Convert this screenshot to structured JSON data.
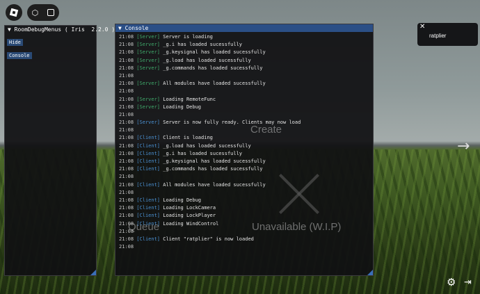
{
  "background": {
    "create_text": "Create",
    "unavailable_text": "Unavailable (W.I.P)",
    "queue_text": "Queue"
  },
  "colors": {
    "server_tag": "#3fa86a",
    "client_tag": "#4a8fcf",
    "title_bar": "#2b4f86",
    "button": "#2a4a75"
  },
  "topbar": {
    "icons": [
      "roblox-logo-icon",
      "cube-icon",
      "chat-list-icon"
    ]
  },
  "debug_menu": {
    "title": "RoomDebugMenus ( Iris  2.2.0 )",
    "buttons": [
      "Hide",
      "Console"
    ]
  },
  "console": {
    "title": "Console",
    "lines": [
      {
        "time": "21:08",
        "tag": "[Server]",
        "tag_type": "server",
        "text": "Server is loading"
      },
      {
        "time": "21:08",
        "tag": "[Server]",
        "tag_type": "server",
        "text": "_g.i has loaded sucessfully"
      },
      {
        "time": "21:08",
        "tag": "[Server]",
        "tag_type": "server",
        "text": "_g.keysignal has loaded sucessfully"
      },
      {
        "time": "21:08",
        "tag": "[Server]",
        "tag_type": "server",
        "text": "_g.load has loaded sucessfully"
      },
      {
        "time": "21:08",
        "tag": "[Server]",
        "tag_type": "server",
        "text": "_g.commands has loaded sucessfully"
      },
      {
        "time": "21:08",
        "tag": "",
        "tag_type": "",
        "text": ""
      },
      {
        "time": "21:08",
        "tag": "[Server]",
        "tag_type": "server",
        "text": "All modules have loaded sucessfully"
      },
      {
        "time": "21:08",
        "tag": "",
        "tag_type": "",
        "text": ""
      },
      {
        "time": "21:08",
        "tag": "[Server]",
        "tag_type": "server",
        "text": "Loading RemoteFunc"
      },
      {
        "time": "21:08",
        "tag": "[Server]",
        "tag_type": "server",
        "text": "Loading Debug"
      },
      {
        "time": "21:08",
        "tag": "",
        "tag_type": "",
        "text": ""
      },
      {
        "time": "21:08",
        "tag": "[Server]",
        "tag_type": "client",
        "text": "Server is now fully ready. Clients may now load"
      },
      {
        "time": "21:08",
        "tag": "",
        "tag_type": "",
        "text": ""
      },
      {
        "time": "21:08",
        "tag": "[Client]",
        "tag_type": "client",
        "text": "Client is loading"
      },
      {
        "time": "21:08",
        "tag": "[Client]",
        "tag_type": "client",
        "text": "_g.load has loaded sucessfully"
      },
      {
        "time": "21:08",
        "tag": "[Client]",
        "tag_type": "client",
        "text": "_g.i has loaded sucessfully"
      },
      {
        "time": "21:08",
        "tag": "[Client]",
        "tag_type": "client",
        "text": "_g.keysignal has loaded sucessfully"
      },
      {
        "time": "21:08",
        "tag": "[Client]",
        "tag_type": "client",
        "text": "_g.commands has loaded sucessfully"
      },
      {
        "time": "21:08",
        "tag": "",
        "tag_type": "",
        "text": ""
      },
      {
        "time": "21:08",
        "tag": "[Client]",
        "tag_type": "client",
        "text": "All modules have loaded sucessfully"
      },
      {
        "time": "21:08",
        "tag": "",
        "tag_type": "",
        "text": ""
      },
      {
        "time": "21:08",
        "tag": "[Client]",
        "tag_type": "client",
        "text": "Loading Debug"
      },
      {
        "time": "21:08",
        "tag": "[Client]",
        "tag_type": "client",
        "text": "Loading LockCamera"
      },
      {
        "time": "21:08",
        "tag": "[Client]",
        "tag_type": "client",
        "text": "Loading LockPlayer"
      },
      {
        "time": "21:08",
        "tag": "[Client]",
        "tag_type": "client",
        "text": "Loading WindControl"
      },
      {
        "time": "21:08",
        "tag": "",
        "tag_type": "",
        "text": ""
      },
      {
        "time": "21:08",
        "tag": "[Client]",
        "tag_type": "client",
        "text": "Client \"ratplier\" is now loaded"
      },
      {
        "time": "21:08",
        "tag": "",
        "tag_type": "",
        "text": ""
      }
    ]
  },
  "notification": {
    "username": "ratplier"
  }
}
